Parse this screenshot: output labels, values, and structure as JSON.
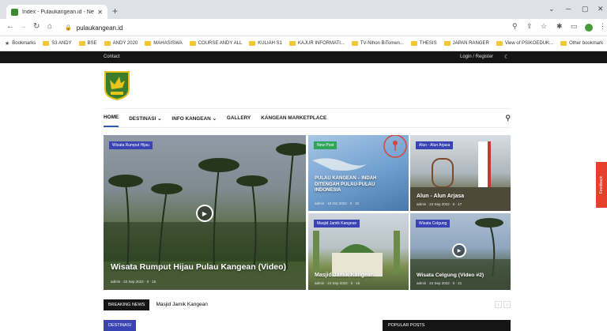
{
  "browser": {
    "tab_title": "Index - Pulaukangean.id - News",
    "url": "pulaukangean.id",
    "bookmarks": [
      "Bookmarks",
      "S3 ANDY",
      "BSE",
      "ANDY 2020",
      "MAHASISWA",
      "COURSE ANDY ALL",
      "KULIAH S1",
      "KAJUR INFORMATI...",
      "TV-Nihon BiTomen...",
      "THESIS",
      "JAPAN RANGER",
      "View of PSIKOEDUK...",
      "Other bookmark"
    ]
  },
  "topbar": {
    "contact": "Contact",
    "login": "Login / Register"
  },
  "nav": {
    "items": [
      "HOME",
      "DESTINASI",
      "INFO KANGEAN",
      "GALLERY",
      "KANGEAN MARKETPLACE"
    ],
    "active": "HOME"
  },
  "cards": {
    "main": {
      "badge": "Wisata Rumput Hijau",
      "title": "Wisata Rumput Hijau Pulau Kangean (Video)",
      "meta": "admin · 22 Sep 2022 · 0 · 15"
    },
    "c1": {
      "badge": "New Post",
      "title": "PULAU KANGEAN – INDAH DITENGAH PULAU-PULAU INDONESIA",
      "meta": "admin · 10 Oct 2022 · 0 · 31"
    },
    "c2": {
      "badge": "Alun - Alun Arjasa",
      "title": "Alun - Alun Arjasa",
      "meta": "admin · 24 Sep 2022 · 0 · 17"
    },
    "c3": {
      "badge": "Masjid Jamik Kangean",
      "title": "Masjid Jamik Kangean",
      "meta": "admin · 24 Sep 2022 · 0 · 15"
    },
    "c4": {
      "badge": "Wisata Celgung",
      "title": "Wisata Celgung (Video #2)",
      "meta": "admin · 24 Sep 2022 · 0 · 21"
    }
  },
  "breaking": {
    "label": "BREAKING NEWS",
    "text": "Masjid Jamik Kangean"
  },
  "sections": {
    "destinasi": "DESTINASI",
    "popular": "POPULAR POSTS"
  },
  "feedback": "Feedback"
}
